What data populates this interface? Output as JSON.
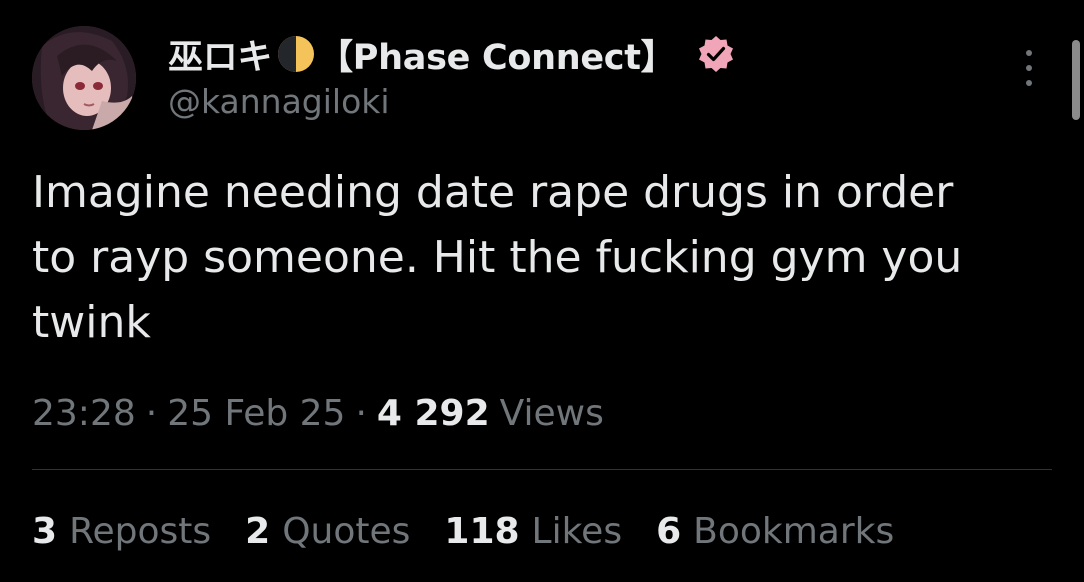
{
  "author": {
    "display_name": "巫ロキ",
    "moon_icon": "moon-icon",
    "org": "【Phase Connect】",
    "verified_icon": "verified-badge-icon",
    "verified_color": "#f0a6b8",
    "handle": "@kannagiloki"
  },
  "tweet": {
    "text": "Imagine needing date rape drugs in order\nto rayp someone. Hit the fucking gym you\ntwink"
  },
  "meta": {
    "time": "23:28",
    "date": "25 Feb 25",
    "separator": "·",
    "views_count": "4 292",
    "views_label": "Views"
  },
  "stats": [
    {
      "count": "3",
      "label": "Reposts"
    },
    {
      "count": "2",
      "label": "Quotes"
    },
    {
      "count": "118",
      "label": "Likes"
    },
    {
      "count": "6",
      "label": "Bookmarks"
    }
  ],
  "colors": {
    "background": "#000000",
    "text_primary": "#e7e9ea",
    "text_secondary": "#71767b",
    "divider": "#2f3336"
  }
}
